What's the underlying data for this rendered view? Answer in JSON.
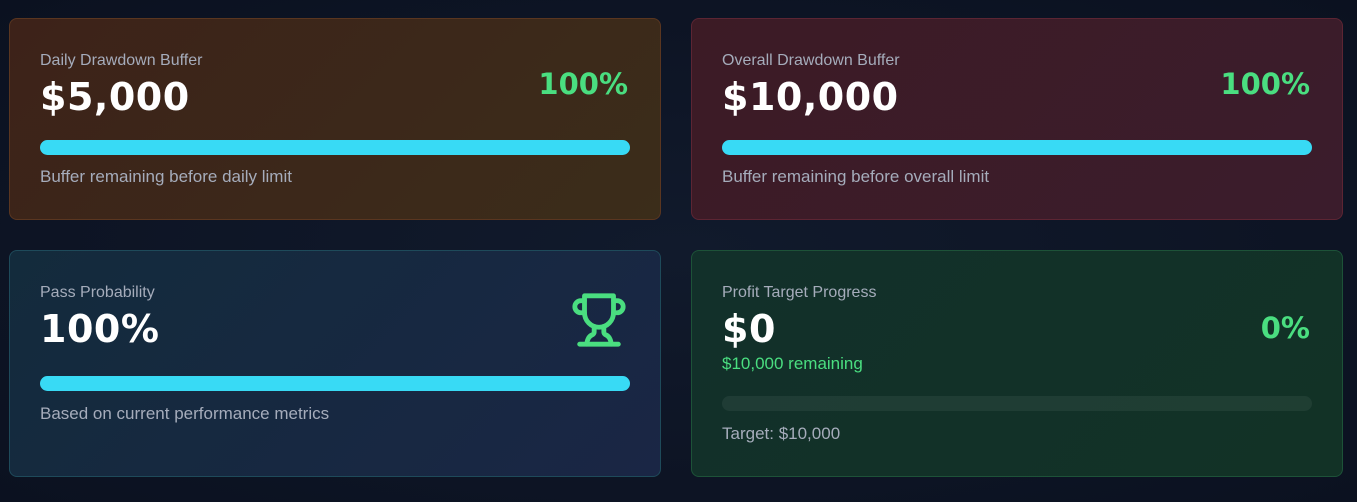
{
  "cards": {
    "daily": {
      "label": "Daily Drawdown Buffer",
      "value": "$5,000",
      "percent": "100%",
      "progress": 1.0,
      "caption": "Buffer remaining before daily limit"
    },
    "overall": {
      "label": "Overall Drawdown Buffer",
      "value": "$10,000",
      "percent": "100%",
      "progress": 1.0,
      "caption": "Buffer remaining before overall limit"
    },
    "pass": {
      "label": "Pass Probability",
      "value": "100%",
      "icon": "trophy-icon",
      "progress": 1.0,
      "caption": "Based on current performance metrics"
    },
    "profit": {
      "label": "Profit Target Progress",
      "value": "$0",
      "percent": "0%",
      "remaining": "$10,000 remaining",
      "progress": 0.0,
      "caption": "Target: $10,000"
    }
  },
  "colors": {
    "accent_bar": "#38daf5",
    "positive": "#4ade80"
  }
}
